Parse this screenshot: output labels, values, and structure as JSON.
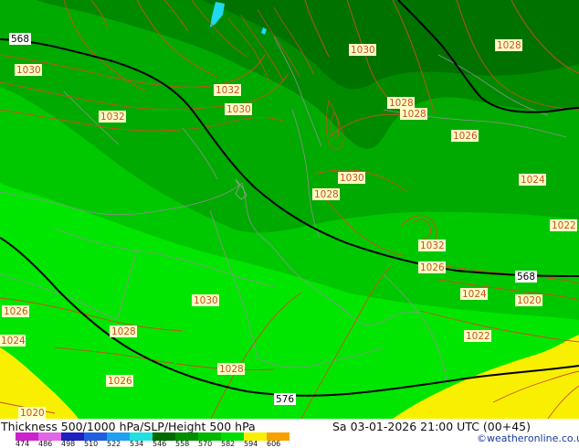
{
  "map": {
    "thickness_isolines": [
      "568",
      "576"
    ],
    "slp_isobar_labels": [
      "1032",
      "1030",
      "1028",
      "1026",
      "1024",
      "1022",
      "1020"
    ],
    "coloring": "500/1000 hPa thickness shading with SLP isobars (red) and 500 hPa height contours (black)"
  },
  "footer": {
    "title": "Thickness 500/1000 hPa/SLP/Height 500 hPa",
    "valid_time": "Sa 03-01-2026 21:00 UTC (00+45)",
    "credit": "©weatheronline.co.uk"
  },
  "color_scale": {
    "ticks": [
      "474",
      "486",
      "498",
      "510",
      "522",
      "534",
      "546",
      "558",
      "570",
      "582",
      "594",
      "606"
    ],
    "colors": [
      "#cc22cc",
      "#e066e6",
      "#2020c0",
      "#2060e0",
      "#20a0f0",
      "#20e0e0",
      "#006a00",
      "#008e00",
      "#00b800",
      "#00e000",
      "#f8f000",
      "#f8a000"
    ]
  },
  "colors": {
    "isobar": "#c8501e",
    "height_contour": "#000000",
    "coastline": "#909090",
    "label_bg": "#ffffc8"
  }
}
